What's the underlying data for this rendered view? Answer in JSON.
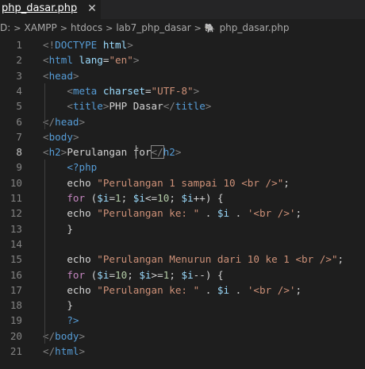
{
  "tab": {
    "title": "php_dasar.php",
    "close": "✕"
  },
  "breadcrumb": {
    "drive": "D:",
    "items": [
      "XAMPP",
      "htdocs",
      "lab7_php_dasar"
    ],
    "file": "php_dasar.php",
    "separator": ">"
  },
  "editor": {
    "active_line": 8,
    "line_numbers": [
      "1",
      "2",
      "3",
      "4",
      "5",
      "6",
      "7",
      "8",
      "9",
      "10",
      "11",
      "12",
      "13",
      "14",
      "15",
      "16",
      "17",
      "18",
      "19",
      "20",
      "21"
    ],
    "lines": [
      [
        [
          "t-punc",
          "<!"
        ],
        [
          "t-doctype",
          "DOCTYPE"
        ],
        [
          "t-text",
          " "
        ],
        [
          "t-attr",
          "html"
        ],
        [
          "t-punc",
          ">"
        ]
      ],
      [
        [
          "t-punc",
          "<"
        ],
        [
          "t-tag",
          "html"
        ],
        [
          "t-text",
          " "
        ],
        [
          "t-attr",
          "lang"
        ],
        [
          "t-text",
          "="
        ],
        [
          "t-str",
          "\"en\""
        ],
        [
          "t-punc",
          ">"
        ]
      ],
      [
        [
          "t-punc",
          "<"
        ],
        [
          "t-tag",
          "head"
        ],
        [
          "t-punc",
          ">"
        ]
      ],
      [
        [
          "t-text",
          "    "
        ],
        [
          "t-punc",
          "<"
        ],
        [
          "t-tag",
          "meta"
        ],
        [
          "t-text",
          " "
        ],
        [
          "t-attr",
          "charset"
        ],
        [
          "t-text",
          "="
        ],
        [
          "t-str",
          "\"UTF-8\""
        ],
        [
          "t-punc",
          ">"
        ]
      ],
      [
        [
          "t-text",
          "    "
        ],
        [
          "t-punc",
          "<"
        ],
        [
          "t-tag",
          "title"
        ],
        [
          "t-punc",
          ">"
        ],
        [
          "t-text",
          "PHP Dasar"
        ],
        [
          "t-punc",
          "</"
        ],
        [
          "t-tag",
          "title"
        ],
        [
          "t-punc",
          ">"
        ]
      ],
      [
        [
          "t-punc",
          "</"
        ],
        [
          "t-tag",
          "head"
        ],
        [
          "t-punc",
          ">"
        ]
      ],
      [
        [
          "t-punc",
          "<"
        ],
        [
          "t-tag",
          "body"
        ],
        [
          "t-punc",
          ">"
        ]
      ],
      [
        [
          "t-punc",
          "<"
        ],
        [
          "t-tag",
          "h2"
        ],
        [
          "t-punc",
          ">"
        ],
        [
          "t-text",
          "Perulangan for"
        ],
        [
          "t-punc match",
          "</"
        ],
        [
          "t-tag",
          "h2"
        ],
        [
          "t-punc",
          ">"
        ]
      ],
      [
        [
          "t-text",
          "    "
        ],
        [
          "t-php",
          "<?php"
        ]
      ],
      [
        [
          "t-text",
          "    echo "
        ],
        [
          "t-str",
          "\"Perulangan 1 sampai 10 <br />\""
        ],
        [
          "t-text",
          ";"
        ]
      ],
      [
        [
          "t-text",
          "    "
        ],
        [
          "t-kw",
          "for"
        ],
        [
          "t-text",
          " ("
        ],
        [
          "t-var",
          "$i"
        ],
        [
          "t-text",
          "="
        ],
        [
          "t-num",
          "1"
        ],
        [
          "t-text",
          "; "
        ],
        [
          "t-var",
          "$i"
        ],
        [
          "t-text",
          "<="
        ],
        [
          "t-num",
          "10"
        ],
        [
          "t-text",
          "; "
        ],
        [
          "t-var",
          "$i"
        ],
        [
          "t-text",
          "++) {"
        ]
      ],
      [
        [
          "t-text",
          "    echo "
        ],
        [
          "t-str",
          "\"Perulangan ke: \""
        ],
        [
          "t-text",
          " . "
        ],
        [
          "t-var",
          "$i"
        ],
        [
          "t-text",
          " . "
        ],
        [
          "t-str",
          "'<br />'"
        ],
        [
          "t-text",
          ";"
        ]
      ],
      [
        [
          "t-text",
          "    }"
        ]
      ],
      [],
      [
        [
          "t-text",
          "    echo "
        ],
        [
          "t-str",
          "\"Perulangan Menurun dari 10 ke 1 <br />\""
        ],
        [
          "t-text",
          ";"
        ]
      ],
      [
        [
          "t-text",
          "    "
        ],
        [
          "t-kw",
          "for"
        ],
        [
          "t-text",
          " ("
        ],
        [
          "t-var",
          "$i"
        ],
        [
          "t-text",
          "="
        ],
        [
          "t-num",
          "10"
        ],
        [
          "t-text",
          "; "
        ],
        [
          "t-var",
          "$i"
        ],
        [
          "t-text",
          ">="
        ],
        [
          "t-num",
          "1"
        ],
        [
          "t-text",
          "; "
        ],
        [
          "t-var",
          "$i"
        ],
        [
          "t-text",
          "--) {"
        ]
      ],
      [
        [
          "t-text",
          "    echo "
        ],
        [
          "t-str",
          "\"Perulangan ke: \""
        ],
        [
          "t-text",
          " . "
        ],
        [
          "t-var",
          "$i"
        ],
        [
          "t-text",
          " . "
        ],
        [
          "t-str",
          "'<br />'"
        ],
        [
          "t-text",
          ";"
        ]
      ],
      [
        [
          "t-text",
          "    }"
        ]
      ],
      [
        [
          "t-text",
          "    "
        ],
        [
          "t-php",
          "?>"
        ]
      ],
      [
        [
          "t-punc",
          "</"
        ],
        [
          "t-tag",
          "body"
        ],
        [
          "t-punc",
          ">"
        ]
      ],
      [
        [
          "t-punc",
          "</"
        ],
        [
          "t-tag",
          "html"
        ],
        [
          "t-punc",
          ">"
        ]
      ]
    ]
  }
}
